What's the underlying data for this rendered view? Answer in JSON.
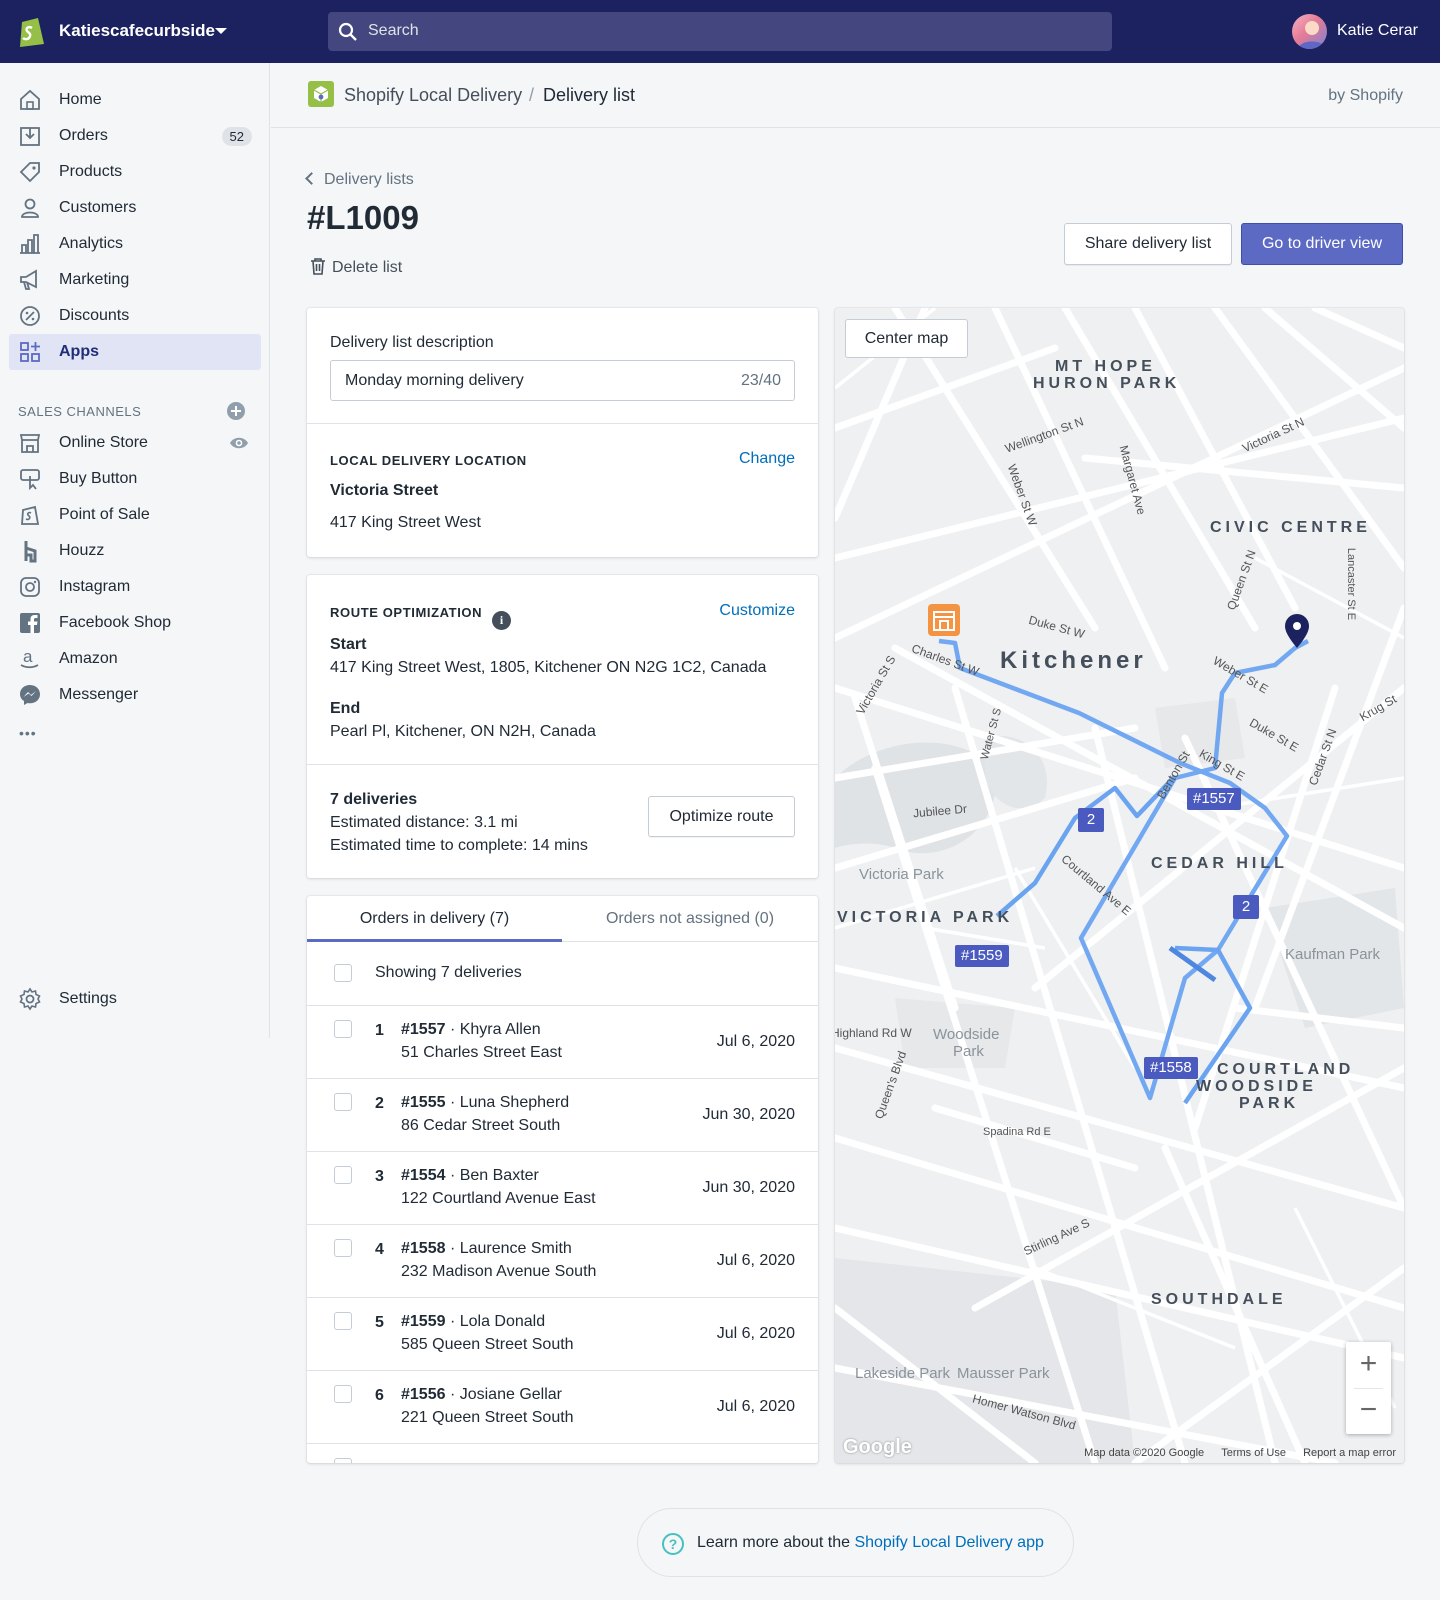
{
  "topbar": {
    "store_name": "Katiescafecurbside",
    "search_placeholder": "Search",
    "user_name": "Katie Cerar"
  },
  "sidebar": {
    "items": [
      {
        "label": "Home",
        "icon": "home-icon"
      },
      {
        "label": "Orders",
        "icon": "orders-icon",
        "badge": "52"
      },
      {
        "label": "Products",
        "icon": "products-icon"
      },
      {
        "label": "Customers",
        "icon": "customers-icon"
      },
      {
        "label": "Analytics",
        "icon": "analytics-icon"
      },
      {
        "label": "Marketing",
        "icon": "marketing-icon"
      },
      {
        "label": "Discounts",
        "icon": "discounts-icon"
      },
      {
        "label": "Apps",
        "icon": "apps-icon",
        "active": true
      }
    ],
    "sales_channels_title": "SALES CHANNELS",
    "channels": [
      {
        "label": "Online Store",
        "icon": "online-store-icon"
      },
      {
        "label": "Buy Button",
        "icon": "buy-button-icon"
      },
      {
        "label": "Point of Sale",
        "icon": "point-of-sale-icon"
      },
      {
        "label": "Houzz",
        "icon": "houzz-icon"
      },
      {
        "label": "Instagram",
        "icon": "instagram-icon"
      },
      {
        "label": "Facebook Shop",
        "icon": "facebook-icon"
      },
      {
        "label": "Amazon",
        "icon": "amazon-icon"
      },
      {
        "label": "Messenger",
        "icon": "messenger-icon"
      }
    ],
    "more": "•••",
    "settings": "Settings"
  },
  "appbar": {
    "app_name": "Shopify Local Delivery",
    "separator": "/",
    "page": "Delivery list",
    "by": "by Shopify"
  },
  "page": {
    "back": "Delivery lists",
    "title": "#L1009",
    "delete": "Delete list",
    "share_button": "Share delivery list",
    "driver_button": "Go to driver view"
  },
  "description_card": {
    "label": "Delivery list description",
    "value": "Monday morning delivery",
    "count": "23/40",
    "location_title": "LOCAL DELIVERY LOCATION",
    "change": "Change",
    "location_name": "Victoria Street",
    "location_address": "417 King Street West"
  },
  "route_card": {
    "title": "ROUTE OPTIMIZATION",
    "customize": "Customize",
    "start_label": "Start",
    "start_address": "417 King Street West, 1805, Kitchener ON N2G 1C2, Canada",
    "end_label": "End",
    "end_address": "Pearl Pl, Kitchener, ON N2H, Canada",
    "deliveries": "7 deliveries",
    "distance": "Estimated distance: 3.1 mi",
    "time": "Estimated time to complete: 14 mins",
    "optimize": "Optimize route"
  },
  "orders_card": {
    "tab_in": "Orders in delivery (7)",
    "tab_out": "Orders not assigned (0)",
    "showing": "Showing 7 deliveries",
    "orders": [
      {
        "num": "1",
        "id": "#1557",
        "name": " · Khyra Allen",
        "address": "51 Charles Street East",
        "date": "Jul 6, 2020"
      },
      {
        "num": "2",
        "id": "#1555",
        "name": " · Luna Shepherd",
        "address": "86 Cedar Street South",
        "date": "Jun 30, 2020"
      },
      {
        "num": "3",
        "id": "#1554",
        "name": " · Ben Baxter",
        "address": "122 Courtland Avenue East",
        "date": "Jun 30, 2020"
      },
      {
        "num": "4",
        "id": "#1558",
        "name": " · Laurence Smith",
        "address": "232 Madison Avenue South",
        "date": "Jul 6, 2020"
      },
      {
        "num": "5",
        "id": "#1559",
        "name": " · Lola Donald",
        "address": "585 Queen Street South",
        "date": "Jul 6, 2020"
      },
      {
        "num": "6",
        "id": "#1556",
        "name": " · Josiane Gellar",
        "address": "221 Queen Street South",
        "date": "Jul 6, 2020"
      }
    ]
  },
  "map": {
    "center_button": "Center map",
    "zoom_in": "+",
    "zoom_out": "−",
    "google": "Google",
    "map_data": "Map data ©2020 Google",
    "terms": "Terms of Use",
    "report": "Report a map error",
    "areas": [
      "MT HOPE",
      "HURON PARK",
      "CIVIC CENTRE",
      "Kitchener",
      "CEDAR HILL",
      "VICTORIA PARK",
      "COURTLAND",
      "WOODSIDE",
      "PARK",
      "SOUTHDALE"
    ],
    "parks": [
      "Victoria Park",
      "Kaufman Park",
      "Woodside",
      "Park",
      "Lakeside Park",
      "Mausser Park"
    ],
    "markers": [
      "#1557",
      "2",
      "2",
      "#1559",
      "#1558"
    ],
    "streets": [
      "Wellington St N",
      "Victoria St N",
      "Weber St W",
      "Duke St W",
      "Charles St W",
      "Jubilee Dr",
      "Courtland Ave E",
      "King St E",
      "Duke St E",
      "Benton St",
      "Queen St N",
      "Weber St E",
      "Stirling Ave S",
      "Homer Watson Blvd",
      "Highland Rd W",
      "Queen's Blvd",
      "Spadina Rd E",
      "Margaret Ave",
      "Cedar St N",
      "Krug St",
      "Victoria St S",
      "Water St S",
      "Lancaster St E"
    ],
    "route_color": "#6aa3f0",
    "marker_color": "#4a5abf",
    "start_color": "#f49342"
  },
  "help": {
    "text": "Learn more about the ",
    "link": "Shopify Local Delivery app"
  }
}
